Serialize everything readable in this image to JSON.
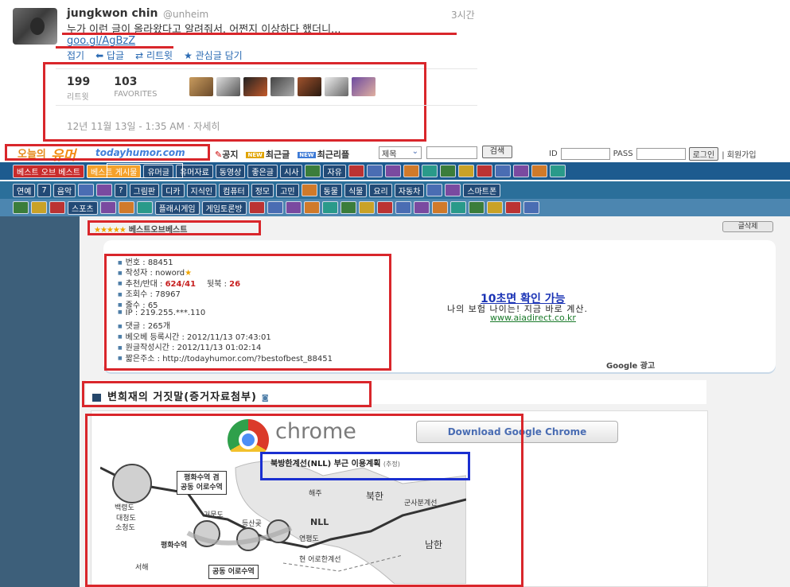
{
  "tweet": {
    "name": "jungkwon chin",
    "handle": "@unheim",
    "time": "3시간",
    "text": "누가 이런 글이 올라왔다고 알려줘서. 어쩐지 이상하다 했더니...",
    "link": "goo.gl/AgBzZ",
    "actions": [
      "접기",
      "답글",
      "리트윗",
      "관심글 담기"
    ],
    "retweets": "199",
    "retweets_label": "리트윗",
    "favorites": "103",
    "favorites_label": "FAVORITES",
    "date": "12년 11월 13일 - 1:35 AM · 자세히"
  },
  "site": {
    "logo_a": "오늘의",
    "logo_b": "유머",
    "logo_c": "todayhumor.com",
    "header_links": [
      "공지",
      "최근글",
      "최근리플"
    ],
    "new_tag": "NEW",
    "search_select": "제목",
    "search_button": "검색",
    "id_label": "ID",
    "pass_label": "PASS",
    "login_button": "로그인",
    "join_link": "| 회원가입"
  },
  "nav": {
    "row1": [
      "베스트 오브 베스트",
      "베스트 게시물",
      "유머글",
      "유머자료",
      "동영상",
      "좋은글",
      "시사",
      "",
      "자유",
      "",
      "",
      "",
      "",
      "",
      "",
      "",
      "",
      "",
      "",
      "",
      ""
    ],
    "row2": [
      "연예",
      "7",
      "음악",
      "",
      "",
      "?",
      "그림판",
      "디카",
      "지식인",
      "컴퓨터",
      "정모",
      "고민",
      "",
      "동물",
      "식물",
      "요리",
      "자동차",
      "",
      "",
      "스마트폰"
    ],
    "row3": [
      "",
      "",
      "",
      "스포츠",
      "",
      "",
      "",
      "플래시게임",
      "게임토론방",
      "",
      "",
      "",
      "",
      "",
      "",
      "",
      "",
      "",
      "",
      "",
      "",
      "",
      "",
      "",
      ""
    ]
  },
  "post": {
    "section_title": "베스트오브베스트",
    "section_stars": "★★★★★",
    "bookmark_button": "글삭제",
    "info": [
      {
        "label": "번호",
        "value": "88451"
      },
      {
        "label": "작성자",
        "value": "noword"
      },
      {
        "label": "추천/반대",
        "value": "624/41",
        "extra_label": "뒷북",
        "extra_value": "26"
      },
      {
        "label": "조회수",
        "value": "78967"
      },
      {
        "label": "줄수",
        "value": "65"
      },
      {
        "label": "IP",
        "value": "219.255.***.110"
      },
      {
        "label": "댓글",
        "value": "265개"
      },
      {
        "label": "베오베 등록시간",
        "value": "2012/11/13 07:43:01"
      },
      {
        "label": "원글작성시간",
        "value": "2012/11/13 01:02:14"
      },
      {
        "label": "짧은주소",
        "value": "http://todayhumor.com/?bestofbest_88451"
      }
    ],
    "title": "변희재의 거짓말(증거자료첨부)"
  },
  "ad": {
    "title": "10초면 확인 가능",
    "subtitle": "나의 보험 나이는! 지금 바로 계산.",
    "url": "www.aiadirect.co.kr",
    "google": "Google 광고"
  },
  "chrome": {
    "word": "chrome",
    "button": "Download Google Chrome"
  },
  "map": {
    "title": "북방한계선(NLL) 부근 이용계획",
    "title_note": "(추정)",
    "labels": [
      "평화수역 겸",
      "공동 어로수역",
      "백령도",
      "대청도",
      "소청도",
      "평화수역",
      "거문도",
      "연평도",
      "해주",
      "북한",
      "군사분계선",
      "NLL",
      "남한",
      "서해",
      "현 어로한계선",
      "공동 어로수역",
      "등산곶"
    ]
  },
  "colors": {
    "highlight_red": "#d9262b",
    "highlight_blue": "#1a2fd0",
    "nav_dark": "#1d5b8f",
    "link": "#2a6ab3"
  }
}
